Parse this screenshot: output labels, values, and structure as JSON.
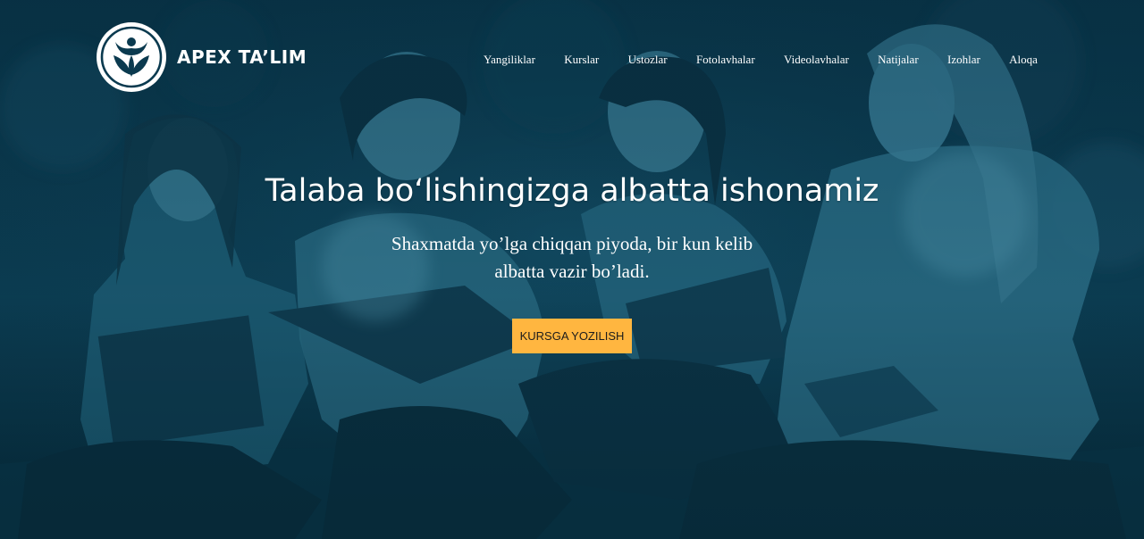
{
  "brand": {
    "name": "APEX TA’LIM",
    "logo_icon": "people-leaves-emblem-icon"
  },
  "nav": {
    "items": [
      {
        "label": "Yangiliklar"
      },
      {
        "label": "Kurslar"
      },
      {
        "label": "Ustozlar"
      },
      {
        "label": "Fotolavhalar"
      },
      {
        "label": "Videolavhalar"
      },
      {
        "label": "Natijalar"
      },
      {
        "label": "Izohlar"
      },
      {
        "label": "Aloqa"
      }
    ]
  },
  "hero": {
    "headline": "Talaba bo‘lishingizga albatta ishonamiz",
    "subtitle_line1": "Shaxmatda yo’lga chiqqan piyoda, bir kun kelib",
    "subtitle_line2": "albatta vazir bo’ladi.",
    "cta_label": "KURSGA YOZILISH",
    "background_image": "students-sitting-on-grass-photo"
  },
  "colors": {
    "overlay_tint": "#0b4a63",
    "cta_background": "#ffb640",
    "text": "#ffffff"
  }
}
